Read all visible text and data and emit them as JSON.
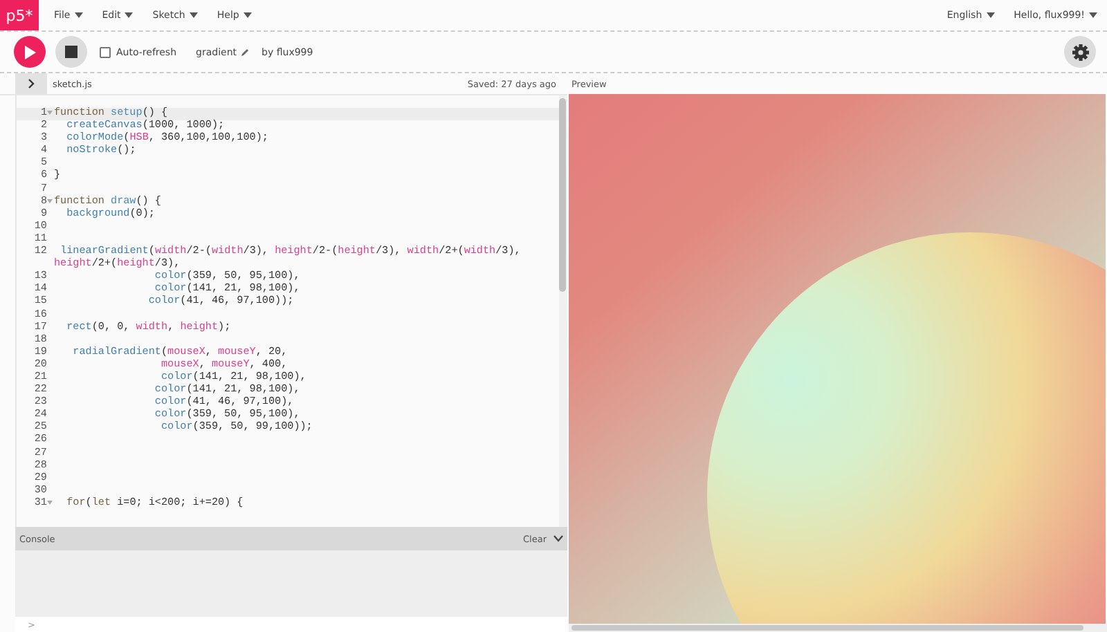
{
  "logo": "p5*",
  "menu": [
    {
      "label": "File"
    },
    {
      "label": "Edit"
    },
    {
      "label": "Sketch"
    },
    {
      "label": "Help"
    }
  ],
  "account_menu": [
    {
      "label": "English"
    },
    {
      "label": "Hello, flux999!"
    }
  ],
  "toolbar": {
    "auto_refresh": {
      "label": "Auto-refresh",
      "checked": false
    },
    "sketch_name": "gradient",
    "author": "by flux999"
  },
  "editor": {
    "file_name": "sketch.js",
    "saved": "Saved: 27 days ago",
    "lines": [
      {
        "number": "1",
        "foldable": true,
        "segments": [
          {
            "kind": "kw",
            "text": "function "
          },
          {
            "kind": "def",
            "text": "setup"
          },
          {
            "kind": "txt",
            "text": "() {"
          }
        ]
      },
      {
        "number": "2",
        "foldable": false,
        "segments": [
          {
            "kind": "fn",
            "text": "  createCanvas"
          },
          {
            "kind": "txt",
            "text": "(1000, 1000);"
          }
        ]
      },
      {
        "number": "3",
        "foldable": false,
        "segments": [
          {
            "kind": "fn",
            "text": "  colorMode"
          },
          {
            "kind": "txt",
            "text": "("
          },
          {
            "kind": "var",
            "text": "HSB"
          },
          {
            "kind": "txt",
            "text": ", 360,100,100,100);"
          }
        ]
      },
      {
        "number": "4",
        "foldable": false,
        "segments": [
          {
            "kind": "fn",
            "text": "  noStroke"
          },
          {
            "kind": "txt",
            "text": "();"
          }
        ]
      },
      {
        "number": "5",
        "foldable": false
      },
      {
        "number": "6",
        "foldable": false,
        "segments": [
          {
            "kind": "txt",
            "text": "}"
          }
        ]
      },
      {
        "number": "7",
        "foldable": false
      },
      {
        "number": "8",
        "foldable": true,
        "segments": [
          {
            "kind": "kw",
            "text": "function "
          },
          {
            "kind": "def",
            "text": "draw"
          },
          {
            "kind": "txt",
            "text": "() {"
          }
        ]
      },
      {
        "number": "9",
        "foldable": false,
        "segments": [
          {
            "kind": "fn",
            "text": "  background"
          },
          {
            "kind": "txt",
            "text": "(0);"
          }
        ]
      },
      {
        "number": "10",
        "foldable": false
      },
      {
        "number": "11",
        "foldable": false
      },
      {
        "number": "12",
        "foldable": false,
        "segments": [
          {
            "kind": "fn",
            "text": " linearGradient"
          },
          {
            "kind": "txt",
            "text": "("
          },
          {
            "kind": "var",
            "text": "width"
          },
          {
            "kind": "txt",
            "text": "/2-("
          },
          {
            "kind": "var",
            "text": "width"
          },
          {
            "kind": "txt",
            "text": "/3), "
          },
          {
            "kind": "var",
            "text": "height"
          },
          {
            "kind": "txt",
            "text": "/2-("
          },
          {
            "kind": "var",
            "text": "height"
          },
          {
            "kind": "txt",
            "text": "/3), "
          },
          {
            "kind": "var",
            "text": "width"
          },
          {
            "kind": "txt",
            "text": "/2+("
          },
          {
            "kind": "var",
            "text": "width"
          },
          {
            "kind": "txt",
            "text": "/3), "
          },
          {
            "kind": "var",
            "text": "height"
          },
          {
            "kind": "txt",
            "text": "/2+("
          },
          {
            "kind": "var",
            "text": "height"
          },
          {
            "kind": "txt",
            "text": "/3),"
          }
        ]
      },
      {
        "number": "13",
        "foldable": false,
        "segments": [
          {
            "kind": "fn",
            "text": "                color"
          },
          {
            "kind": "txt",
            "text": "(359, 50, 95,100),"
          }
        ]
      },
      {
        "number": "14",
        "foldable": false,
        "segments": [
          {
            "kind": "fn",
            "text": "                color"
          },
          {
            "kind": "txt",
            "text": "(141, 21, 98,100),"
          }
        ]
      },
      {
        "number": "15",
        "foldable": false,
        "segments": [
          {
            "kind": "fn",
            "text": "               color"
          },
          {
            "kind": "txt",
            "text": "(41, 46, 97,100));"
          }
        ]
      },
      {
        "number": "16",
        "foldable": false
      },
      {
        "number": "17",
        "foldable": false,
        "segments": [
          {
            "kind": "fn",
            "text": "  rect"
          },
          {
            "kind": "txt",
            "text": "(0, 0, "
          },
          {
            "kind": "var",
            "text": "width"
          },
          {
            "kind": "txt",
            "text": ", "
          },
          {
            "kind": "var",
            "text": "height"
          },
          {
            "kind": "txt",
            "text": ");"
          }
        ]
      },
      {
        "number": "18",
        "foldable": false
      },
      {
        "number": "19",
        "foldable": false,
        "segments": [
          {
            "kind": "fn",
            "text": "   radialGradient"
          },
          {
            "kind": "txt",
            "text": "("
          },
          {
            "kind": "var",
            "text": "mouseX"
          },
          {
            "kind": "txt",
            "text": ", "
          },
          {
            "kind": "var",
            "text": "mouseY"
          },
          {
            "kind": "txt",
            "text": ", 20,"
          }
        ]
      },
      {
        "number": "20",
        "foldable": false,
        "segments": [
          {
            "kind": "var",
            "text": "                 mouseX"
          },
          {
            "kind": "txt",
            "text": ", "
          },
          {
            "kind": "var",
            "text": "mouseY"
          },
          {
            "kind": "txt",
            "text": ", 400,"
          }
        ]
      },
      {
        "number": "21",
        "foldable": false,
        "segments": [
          {
            "kind": "fn",
            "text": "                 color"
          },
          {
            "kind": "txt",
            "text": "(141, 21, 98,100),"
          }
        ]
      },
      {
        "number": "22",
        "foldable": false,
        "segments": [
          {
            "kind": "fn",
            "text": "                color"
          },
          {
            "kind": "txt",
            "text": "(141, 21, 98,100),"
          }
        ]
      },
      {
        "number": "23",
        "foldable": false,
        "segments": [
          {
            "kind": "fn",
            "text": "                color"
          },
          {
            "kind": "txt",
            "text": "(41, 46, 97,100),"
          }
        ]
      },
      {
        "number": "24",
        "foldable": false,
        "segments": [
          {
            "kind": "fn",
            "text": "                color"
          },
          {
            "kind": "txt",
            "text": "(359, 50, 95,100),"
          }
        ]
      },
      {
        "number": "25",
        "foldable": false,
        "segments": [
          {
            "kind": "fn",
            "text": "                 color"
          },
          {
            "kind": "txt",
            "text": "(359, 50, 99,100));"
          }
        ]
      },
      {
        "number": "26",
        "foldable": false
      },
      {
        "number": "27",
        "foldable": false
      },
      {
        "number": "28",
        "foldable": false
      },
      {
        "number": "29",
        "foldable": false
      },
      {
        "number": "30",
        "foldable": false
      },
      {
        "number": "31",
        "foldable": true,
        "segments": [
          {
            "kind": "kw",
            "text": "  for"
          },
          {
            "kind": "txt",
            "text": "("
          },
          {
            "kind": "kw",
            "text": "let"
          },
          {
            "kind": "txt",
            "text": " i=0; i<200; i+=20) {"
          }
        ]
      }
    ]
  },
  "console": {
    "title": "Console",
    "clear": "Clear",
    "prompt": ">"
  },
  "preview": {
    "title": "Preview"
  }
}
